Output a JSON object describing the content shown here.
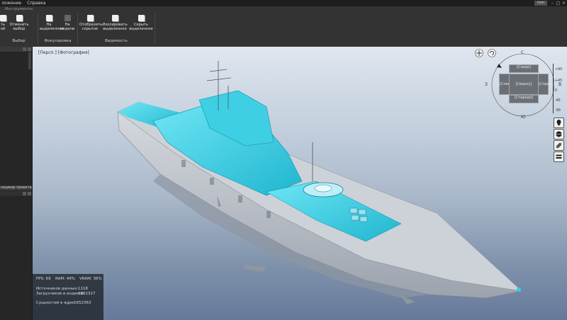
{
  "menu": {
    "items": [
      "ложение",
      "Справка"
    ]
  },
  "window": {
    "user_badge": "rvm"
  },
  "ribbon": {
    "tab_label": "Инструменты",
    "groups": [
      {
        "title": "Выбор",
        "buttons": [
          {
            "line1": "ть",
            "line2": "ой"
          },
          {
            "line1": "Отменить",
            "line2": "выбор"
          }
        ]
      },
      {
        "title": "Фокусировка",
        "buttons": [
          {
            "line1": "На",
            "line2": "выделенном"
          },
          {
            "line1": "На",
            "line2": "модели"
          }
        ]
      },
      {
        "title": "Видимость",
        "buttons": [
          {
            "line1": "Отобразить",
            "line2": "скрытое"
          },
          {
            "line1": "Изолировать",
            "line2": "выделенное"
          },
          {
            "line1": "Скрыть",
            "line2": "выделенное"
          }
        ]
      }
    ]
  },
  "left_panel": {
    "bottom_title": "неджер проекта"
  },
  "viewport": {
    "label": "[Персп.] [Фотография]"
  },
  "stats": {
    "fps": "FPS: 69",
    "ram": "RAM: 49%",
    "vram": "VRAM: 36%",
    "sources_label": "Источников данных:",
    "sources_value": "1118",
    "loaders_label": "Загрузчиков в индексе:",
    "loaders_value": "1652327",
    "entities_label": "Сущностей в ядре:",
    "entities_value": "1652363"
  },
  "viewcube": {
    "north": "С",
    "south": "Ю",
    "west": "З",
    "east": "В",
    "back": "[Сзади]",
    "left": "[Слева]",
    "top": "[Сверху]",
    "right": "[Справа]",
    "front": "[Спереди]"
  },
  "ruler": {
    "ticks": [
      "+90",
      "+45",
      "0",
      "-45",
      "-90"
    ]
  },
  "icons": [
    "pan-icon",
    "orbit-icon",
    "location-pin-icon",
    "globe-icon",
    "measure-icon",
    "layers-icon"
  ],
  "colors": {
    "accent": "#2fd0e8",
    "ship_gray": "#c9cdd3"
  }
}
